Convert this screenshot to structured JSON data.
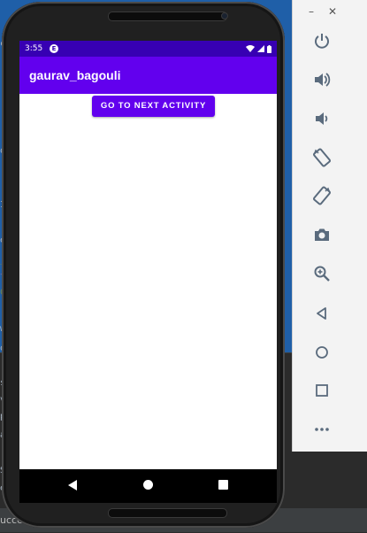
{
  "device": {
    "status_time": "3:55",
    "app_badge": "E"
  },
  "app": {
    "title": "gaurav_bagouli",
    "next_button_label": "GO TO NEXT ACTIVITY"
  },
  "ide": {
    "left_fragments": [
      "c",
      "o",
      "I",
      "e",
      "_",
      "t",
      "C",
      "w",
      "o",
      "s",
      "v",
      "p",
      "a",
      "S",
      "e"
    ],
    "status_text": "ucce"
  },
  "toolbar": {
    "minimize": "–",
    "close": "✕",
    "items": [
      "power-icon",
      "volume-up-icon",
      "volume-down-icon",
      "rotate-left-icon",
      "rotate-right-icon",
      "camera-icon",
      "zoom-icon",
      "back-icon",
      "home-icon",
      "overview-icon",
      "more-icon"
    ]
  },
  "colors": {
    "primary": "#6200ee",
    "primary_dark": "#3700b3",
    "toolbar_icon": "#5a6b7d"
  }
}
